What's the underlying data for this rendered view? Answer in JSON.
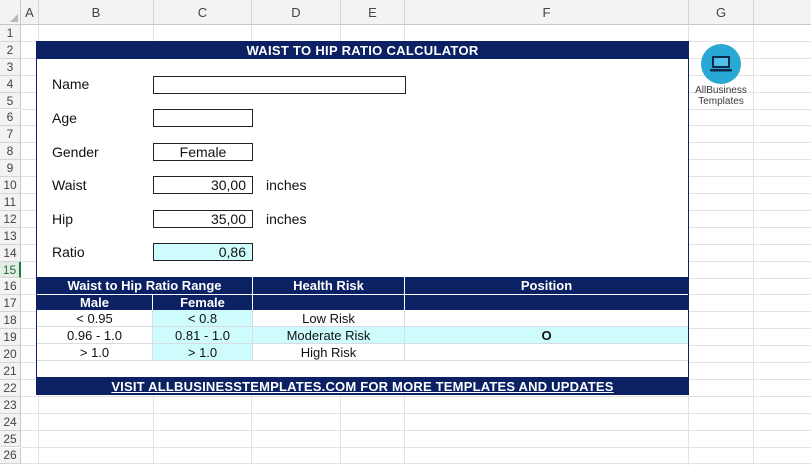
{
  "columns": [
    "A",
    "B",
    "C",
    "D",
    "E",
    "F",
    "G"
  ],
  "rows": [
    "1",
    "2",
    "3",
    "4",
    "5",
    "6",
    "7",
    "8",
    "9",
    "10",
    "11",
    "12",
    "13",
    "14",
    "15",
    "16",
    "17",
    "18",
    "19",
    "20",
    "21",
    "22",
    "23",
    "24",
    "25",
    "26"
  ],
  "selected_row": "15",
  "calculator": {
    "title": "WAIST TO HIP RATIO CALCULATOR",
    "name_label": "Name",
    "name_value": "",
    "age_label": "Age",
    "age_value": "",
    "gender_label": "Gender",
    "gender_value": "Female",
    "waist_label": "Waist",
    "waist_value": "30,00",
    "waist_unit": "inches",
    "hip_label": "Hip",
    "hip_value": "35,00",
    "hip_unit": "inches",
    "ratio_label": "Ratio",
    "ratio_value": "0,86"
  },
  "table": {
    "header_range": "Waist to Hip Ratio Range",
    "header_risk": "Health Risk",
    "header_position": "Position",
    "sub_male": "Male",
    "sub_female": "Female",
    "rows": [
      {
        "male": "< 0.95",
        "female": "< 0.8",
        "risk": "Low Risk",
        "position": ""
      },
      {
        "male": "0.96 - 1.0",
        "female": "0.81 - 1.0",
        "risk": "Moderate Risk",
        "position": "O"
      },
      {
        "male": "> 1.0",
        "female": "> 1.0",
        "risk": "High Risk",
        "position": ""
      }
    ]
  },
  "footer": "VISIT ALLBUSINESSTEMPLATES.COM FOR MORE TEMPLATES AND UPDATES",
  "logo": {
    "line1": "AllBusiness",
    "line2": "Templates",
    "icon": "laptop-icon"
  },
  "colors": {
    "navy": "#0b2163",
    "cyan": "#cefcfc",
    "logo_blue": "#29a8d6"
  }
}
